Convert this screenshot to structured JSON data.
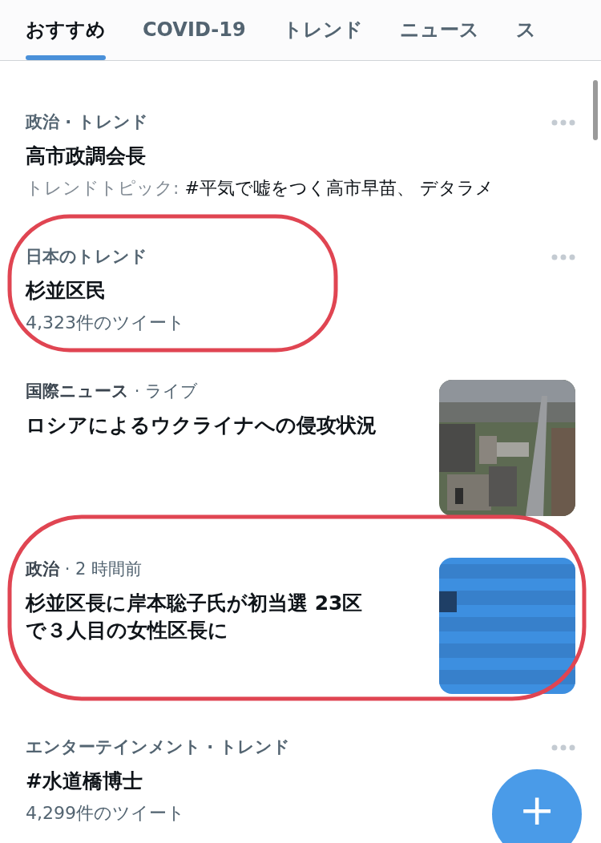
{
  "tabs": [
    {
      "label": "おすすめ",
      "selected": true
    },
    {
      "label": "COVID-19",
      "selected": false
    },
    {
      "label": "トレンド",
      "selected": false
    },
    {
      "label": "ニュース",
      "selected": false
    },
    {
      "label": "ス",
      "selected": false
    }
  ],
  "items": [
    {
      "kind": "trend",
      "category": "政治 · トレンド",
      "title": "高市政調会長",
      "subtitle_label": "トレンドトピック: ",
      "subtitle": "#平気で嘘をつく高市早苗、 デタラメ",
      "circled": false
    },
    {
      "kind": "trend",
      "category": "日本のトレンド",
      "title": "杉並区民",
      "subtitle": "4,323件のツイート",
      "circled": true
    },
    {
      "kind": "news",
      "category": "国際ニュース",
      "meta": " · ライブ",
      "title": "ロシアによるウクライナへの侵攻状況",
      "circled": false
    },
    {
      "kind": "news",
      "category": "政治",
      "meta": " · 2 時間前",
      "title": "杉並区長に岸本聡子氏が初当選 23区で３人目の女性区長に",
      "circled": true
    },
    {
      "kind": "trend",
      "category": "エンターテインメント · トレンド",
      "title": "#水道橋博士",
      "subtitle": "4,299件のツイート",
      "circled": false
    }
  ],
  "compose_button": "+"
}
